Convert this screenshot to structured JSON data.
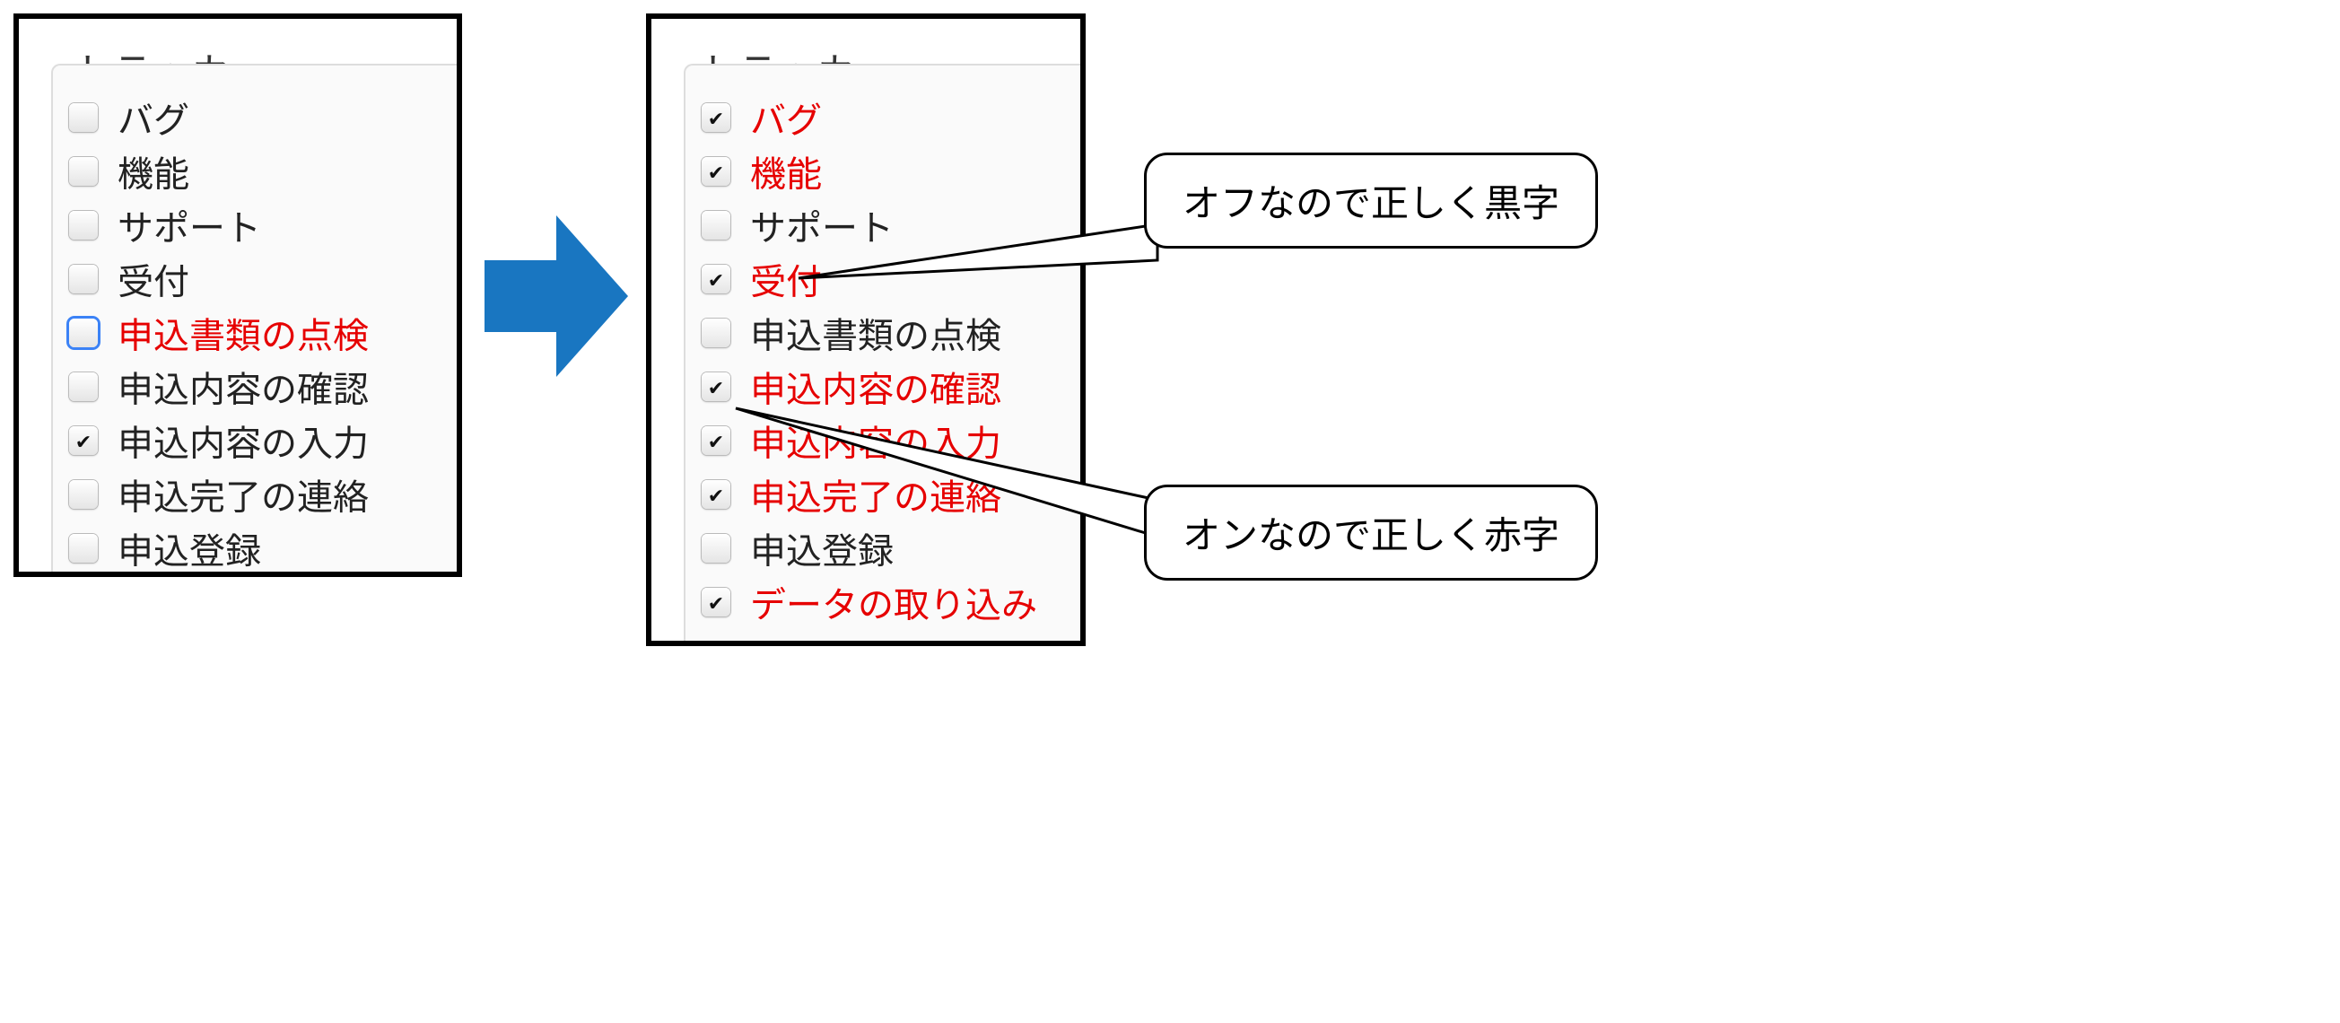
{
  "panels": {
    "left": {
      "title": "トラッカー",
      "items": [
        {
          "label": "バグ",
          "checked": false,
          "red": false,
          "focused": false
        },
        {
          "label": "機能",
          "checked": false,
          "red": false,
          "focused": false
        },
        {
          "label": "サポート",
          "checked": false,
          "red": false,
          "focused": false
        },
        {
          "label": "受付",
          "checked": false,
          "red": false,
          "focused": false
        },
        {
          "label": "申込書類の点検",
          "checked": false,
          "red": true,
          "focused": true
        },
        {
          "label": "申込内容の確認",
          "checked": false,
          "red": false,
          "focused": false
        },
        {
          "label": "申込内容の入力",
          "checked": true,
          "red": false,
          "focused": false
        },
        {
          "label": "申込完了の連絡",
          "checked": false,
          "red": false,
          "focused": false
        },
        {
          "label": "申込登録",
          "checked": false,
          "red": false,
          "focused": false
        }
      ]
    },
    "right": {
      "title": "トラッカー",
      "items": [
        {
          "label": "バグ",
          "checked": true,
          "red": true
        },
        {
          "label": "機能",
          "checked": true,
          "red": true
        },
        {
          "label": "サポート",
          "checked": false,
          "red": false
        },
        {
          "label": "受付",
          "checked": true,
          "red": true
        },
        {
          "label": "申込書類の点検",
          "checked": false,
          "red": false
        },
        {
          "label": "申込内容の確認",
          "checked": true,
          "red": true
        },
        {
          "label": "申込内容の入力",
          "checked": true,
          "red": true
        },
        {
          "label": "申込完了の連絡",
          "checked": true,
          "red": true
        },
        {
          "label": "申込登録",
          "checked": false,
          "red": false
        },
        {
          "label": "データの取り込み",
          "checked": true,
          "red": true
        }
      ]
    }
  },
  "callouts": {
    "top": "オフなので正しく黒字",
    "bottom": "オンなので正しく赤字"
  },
  "colors": {
    "arrow": "#1976c1",
    "red": "#e60000"
  }
}
